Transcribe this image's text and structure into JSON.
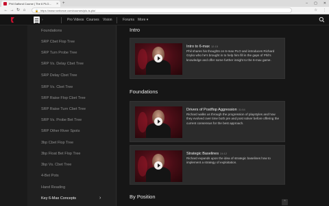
{
  "browser": {
    "tab_title": "Phil Galfond Course | The 6 PLO...",
    "tab_close": "×",
    "new_tab": "+",
    "url": "https://www.runitonce.com/courses/plo-is-plo/",
    "window_controls": [
      "–",
      "▢",
      "✕"
    ],
    "nav": [
      "←",
      "→",
      "↻",
      "⌂"
    ],
    "toolbar_icons": [
      "☆",
      "⋮"
    ]
  },
  "header": {
    "nav_items": [
      "Pro Videos",
      "Courses",
      "Vision",
      "Forums",
      "More ▾"
    ]
  },
  "sidebar": {
    "items": [
      "Foundations",
      "SRP Cbet Flop Tree",
      "SRP Turn Probe Tree",
      "SRP Vs. Delay Cbet Tree",
      "SRP Delay Cbet Tree",
      "SRP Vs. Cbet Tree",
      "SRP Raise Flop Cbet Tree",
      "SRP Raise Turn Cbet Tree",
      "SRP Vs. Probe Bet Tree",
      "SRP Other River Spots",
      "3bp Cbet Flop Tree",
      "3bp Float Bet Flop Tree",
      "3bp Vs. Cbet Tree",
      "4-Bet Pots",
      "Hand Reading",
      "Key 6-Max Concepts"
    ],
    "active_index": 15,
    "chevron": "›"
  },
  "main": {
    "sections": [
      {
        "title": "Intro",
        "cards": [
          {
            "title": "Intro to 6-max",
            "duration": "12:15",
            "desc": "Phil shares his thoughts on 6-max PLO and introduces Richard Gryko who he's brought in to help him fill in the gaps of Phil's knowledge and offer some further insight to the 6-max game."
          }
        ]
      },
      {
        "title": "Foundations",
        "cards": [
          {
            "title": "Drivers of Postflop Aggression",
            "duration": "31:54",
            "desc": "Richard walks us through the progression of playstyles and how they evolved over time both pre and post solver before offering the current consensus for the best approach."
          },
          {
            "title": "Strategic Baselines",
            "duration": "24:12",
            "desc": "Richard expands upon the idea of strategic baselines how to implement a strategy of exploitation."
          }
        ]
      },
      {
        "title": "By Position",
        "cards": []
      }
    ]
  },
  "scroll_top": "⌃"
}
